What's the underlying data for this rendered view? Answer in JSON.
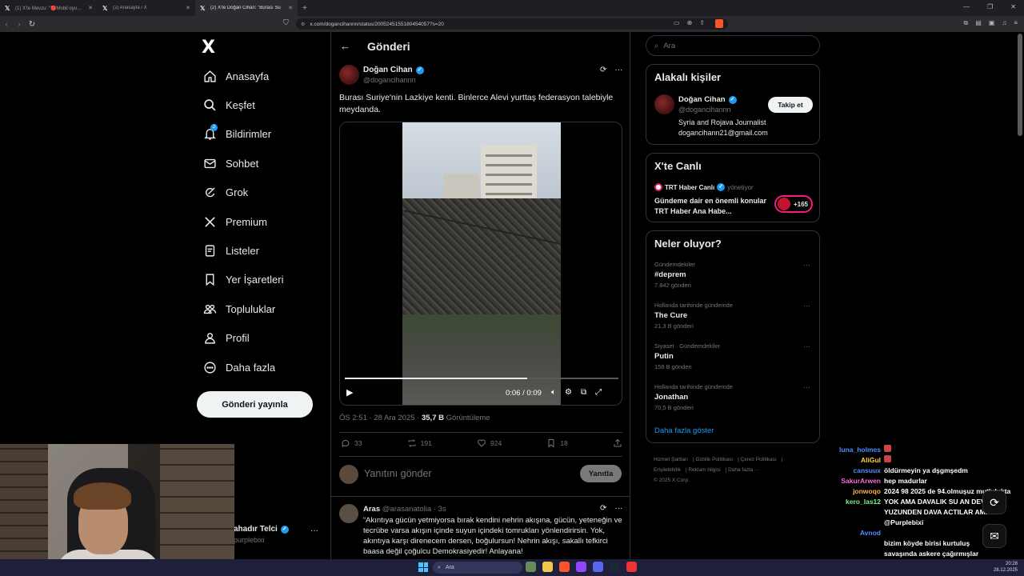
{
  "browser": {
    "tabs": [
      {
        "label": "(1) X'te Mevzu: \"🔴Mobil oyunda Ru",
        "active": false
      },
      {
        "label": "(2) Anasayfa / X",
        "active": false
      },
      {
        "label": "(2) X'te Doğan Cihan: \"Burası Su",
        "active": true
      }
    ],
    "new_tab": "+",
    "url": "x.com/dogancihannn/status/2005245155180454057?s=20"
  },
  "sidebar": {
    "logo": "X",
    "items": [
      {
        "label": "Anasayfa",
        "icon": "home-icon"
      },
      {
        "label": "Keşfet",
        "icon": "search-icon"
      },
      {
        "label": "Bildirimler",
        "icon": "bell-icon",
        "badge": "2"
      },
      {
        "label": "Sohbet",
        "icon": "mail-icon"
      },
      {
        "label": "Grok",
        "icon": "grok-icon"
      },
      {
        "label": "Premium",
        "icon": "x-logo-icon"
      },
      {
        "label": "Listeler",
        "icon": "list-icon"
      },
      {
        "label": "Yer İşaretleri",
        "icon": "bookmark-icon"
      },
      {
        "label": "Topluluklar",
        "icon": "communities-icon"
      },
      {
        "label": "Profil",
        "icon": "profile-icon"
      },
      {
        "label": "Daha fazla",
        "icon": "more-circle-icon"
      }
    ],
    "post_button": "Gönderi yayınla",
    "account": {
      "name": "ahadır Telci",
      "handle": "purplebixi"
    }
  },
  "main": {
    "header_title": "Gönderi",
    "tweet": {
      "author_name": "Doğan Cihan",
      "author_handle": "@dogancihannn",
      "text": "Burası Suriye'nin Lazkiye kenti. Binlerce Alevi yurttaş federasyon talebiyle meydanda.",
      "video": {
        "time": "0:06 / 0:09",
        "progress": 0.667
      },
      "time": "ÖS 2:51 · 28 Ara 2025 · ",
      "views_count": "35,7 B",
      "views_label": " Görüntüleme",
      "stats": {
        "replies": "33",
        "reposts": "191",
        "likes": "924",
        "bookmarks": "18"
      }
    },
    "reply_box": {
      "placeholder": "Yanıtını gönder",
      "button": "Yanıtla"
    },
    "reply": {
      "name": "Aras",
      "handle": "@arasanatolia · 3s",
      "text": "“Akıntıya gücün yetmiyorsa bırak kendini nehrin akışına, gücün, yeteneğin ve tecrübe varsa akışın içinde suyun içindeki tomrukları yönlendirirsin. Yok, akıntıya karşı direnecem dersen, boğulursun! Nehrin akışı, sakallı tefkirci baasa değil çoğulcu Demokrasiyedir! Anlayana!"
    }
  },
  "right": {
    "search_placeholder": "Ara",
    "relevant_people": {
      "title": "Alakalı kişiler",
      "name": "Doğan Cihan",
      "handle": "@dogancihannn",
      "follow": "Takip et",
      "bio_line1": "Syria and Rojava Journalist",
      "bio_line2": "dogancihann21@gmail.com"
    },
    "live": {
      "title": "X'te Canlı",
      "host": "TRT Haber Canlı",
      "role": "yönetiyor",
      "broadcast": "Gündeme dair en önemli konular TRT Haber Ana Habe...",
      "count": "+165"
    },
    "trends": {
      "title": "Neler oluyor?",
      "items": [
        {
          "context": "Gündemdekiler",
          "name": "#deprem",
          "count": "7.842 gönderi"
        },
        {
          "context": "Hollanda tarihinde gündemde",
          "name": "The Cure",
          "count": "21,3 B gönderi"
        },
        {
          "context": "Siyaset · Gündemdekiler",
          "name": "Putin",
          "count": "158 B gönderi"
        },
        {
          "context": "Hollanda tarihinde gündemde",
          "name": "Jonathan",
          "count": "70,5 B gönderi"
        }
      ],
      "show_more": "Daha fazla göster"
    },
    "footer": {
      "links": [
        "Hizmet Şartları",
        "Gizlilik Politikası",
        "Çerez Politikası",
        "Erişilebilirlik",
        "Reklam bilgisi",
        "Daha fazla ···"
      ],
      "copyright": "© 2025 X Corp."
    }
  },
  "chat": [
    {
      "user": "luna_holmes",
      "color": "#4e8fff",
      "msg": ""
    },
    {
      "user": "AliGul",
      "color": "#ffd23c",
      "msg": ""
    },
    {
      "user": "cansuux",
      "color": "#4e8fff",
      "msg": "öldürmeyin ya dşgmşedm"
    },
    {
      "user": "SakurArwen",
      "color": "#ff6ad5",
      "msg": "hep madurlar"
    },
    {
      "user": "jonwoqo",
      "color": "#ffb347",
      "msg": "2024 98 2025 de 94.olmuşuz mutlulukta"
    },
    {
      "user": "kero_las12",
      "color": "#7cf27c",
      "msg": "YOK AMA DAVALIK SU AN DEVLET YUZUNDEN DAVA ACTILAR AMA @Purplebixi"
    },
    {
      "user": "Avnod",
      "color": "#4e8fff",
      "msg": ""
    },
    {
      "user": "",
      "color": "#ffffff",
      "msg": "bizim köyde birisi kurtuluş savaşında askere çağırmışlar gitmemek için gözlerine mil çekmiş"
    }
  ],
  "taskbar": {
    "search": "Ara",
    "time": "20:28",
    "date": "28.12.2025"
  }
}
